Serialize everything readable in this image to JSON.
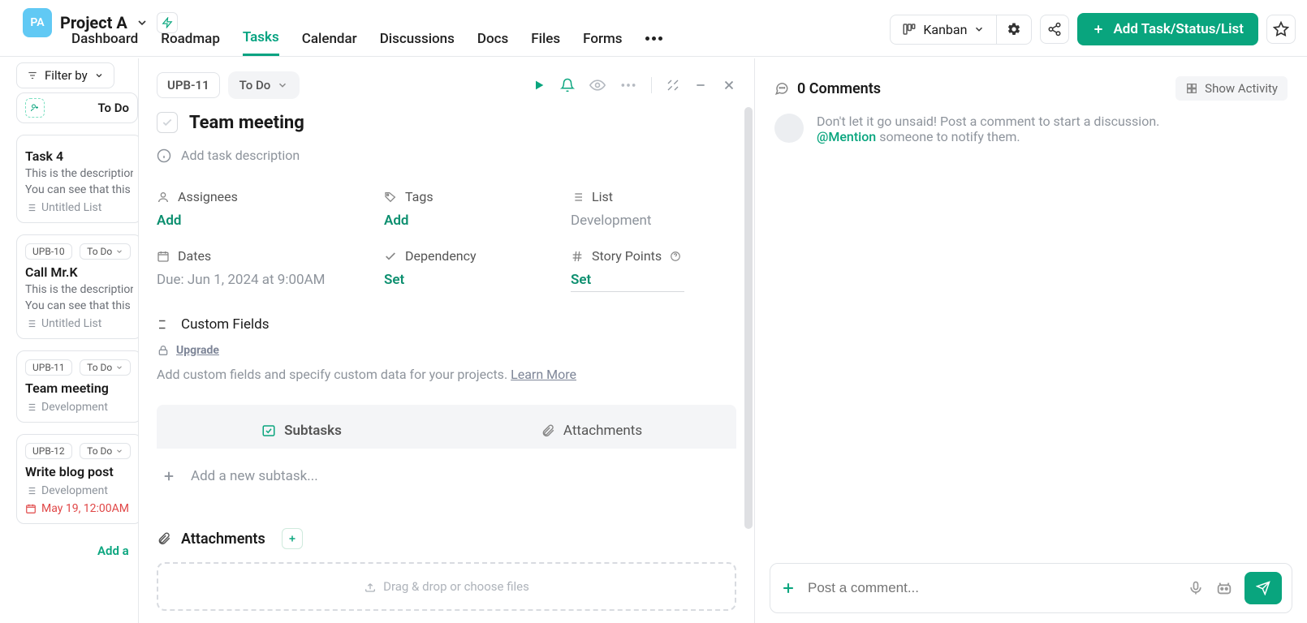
{
  "project": {
    "initials": "PA",
    "name": "Project A"
  },
  "nav_tabs": [
    "Dashboard",
    "Roadmap",
    "Tasks",
    "Calendar",
    "Discussions",
    "Docs",
    "Files",
    "Forms"
  ],
  "nav_active": "Tasks",
  "view_switch": "Kanban",
  "add_button": "Add Task/Status/List",
  "filter_label": "Filter by",
  "left": {
    "list_title": "To Do",
    "cards": [
      {
        "id": null,
        "status": null,
        "title": "Task 4",
        "desc1": "This is the description of a",
        "desc2": "You can see that this",
        "list": "Untitled List",
        "due": null,
        "due_red": false
      },
      {
        "id": "UPB-10",
        "status": "To Do",
        "title": "Call Mr.K",
        "desc1": "This is the description of a",
        "desc2": "You can see that this",
        "list": "Untitled List",
        "due": null,
        "due_red": false
      },
      {
        "id": "UPB-11",
        "status": "To Do",
        "title": "Team meeting",
        "desc1": null,
        "desc2": null,
        "list": "Development",
        "due": null,
        "due_red": false
      },
      {
        "id": "UPB-12",
        "status": "To Do",
        "title": "Write blog post",
        "desc1": null,
        "desc2": null,
        "list": "Development",
        "due": "May 19, 12:00AM",
        "due_red": true
      }
    ],
    "add_label": "Add a"
  },
  "task": {
    "id": "UPB-11",
    "status": "To Do",
    "title": "Team meeting",
    "add_desc": "Add task description",
    "fields": {
      "assignees_label": "Assignees",
      "assignees_value": "Add",
      "tags_label": "Tags",
      "tags_value": "Add",
      "list_label": "List",
      "list_value": "Development",
      "dates_label": "Dates",
      "dates_value": "Due: Jun 1, 2024 at 9:00AM",
      "dependency_label": "Dependency",
      "dependency_value": "Set",
      "story_label": "Story Points",
      "story_value": "Set"
    },
    "custom_fields": {
      "label": "Custom Fields",
      "upgrade": "Upgrade",
      "text_pre": "Add custom fields and specify custom data for your projects. ",
      "learn_more": "Learn More"
    },
    "subtabs": {
      "subtasks": "Subtasks",
      "attachments": "Attachments"
    },
    "subtask_add": "Add a new subtask...",
    "attachments_heading": "Attachments",
    "dropzone": "Drag & drop or choose files"
  },
  "comments": {
    "count_label": "0 Comments",
    "show_activity": "Show Activity",
    "empty_line1": "Don't let it go unsaid! Post a comment to start a discussion.",
    "mention": "@Mention",
    "empty_line2": " someone to notify them.",
    "composer_placeholder": "Post a comment..."
  }
}
